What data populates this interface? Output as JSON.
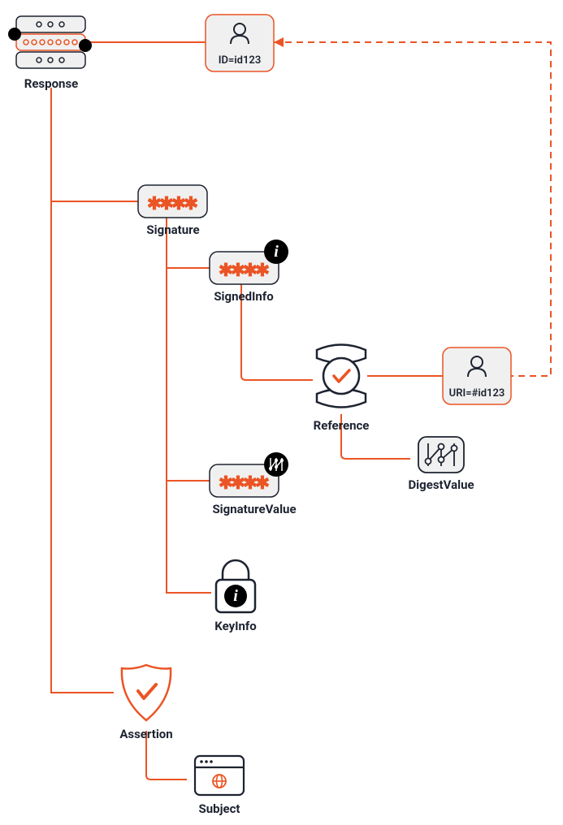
{
  "colors": {
    "accent": "#eb5424",
    "text": "#1d2330",
    "box": "#f0f0f0"
  },
  "nodes": {
    "response": {
      "label": "Response"
    },
    "idBox": {
      "label": "ID=id123"
    },
    "signature": {
      "label": "Signature"
    },
    "signedInfo": {
      "label": "SignedInfo"
    },
    "reference": {
      "label": "Reference"
    },
    "uriBox": {
      "label": "URI=#id123"
    },
    "digestValue": {
      "label": "DigestValue"
    },
    "signatureValue": {
      "label": "SignatureValue"
    },
    "keyInfo": {
      "label": "KeyInfo"
    },
    "assertion": {
      "label": "Assertion"
    },
    "subject": {
      "label": "Subject"
    }
  }
}
